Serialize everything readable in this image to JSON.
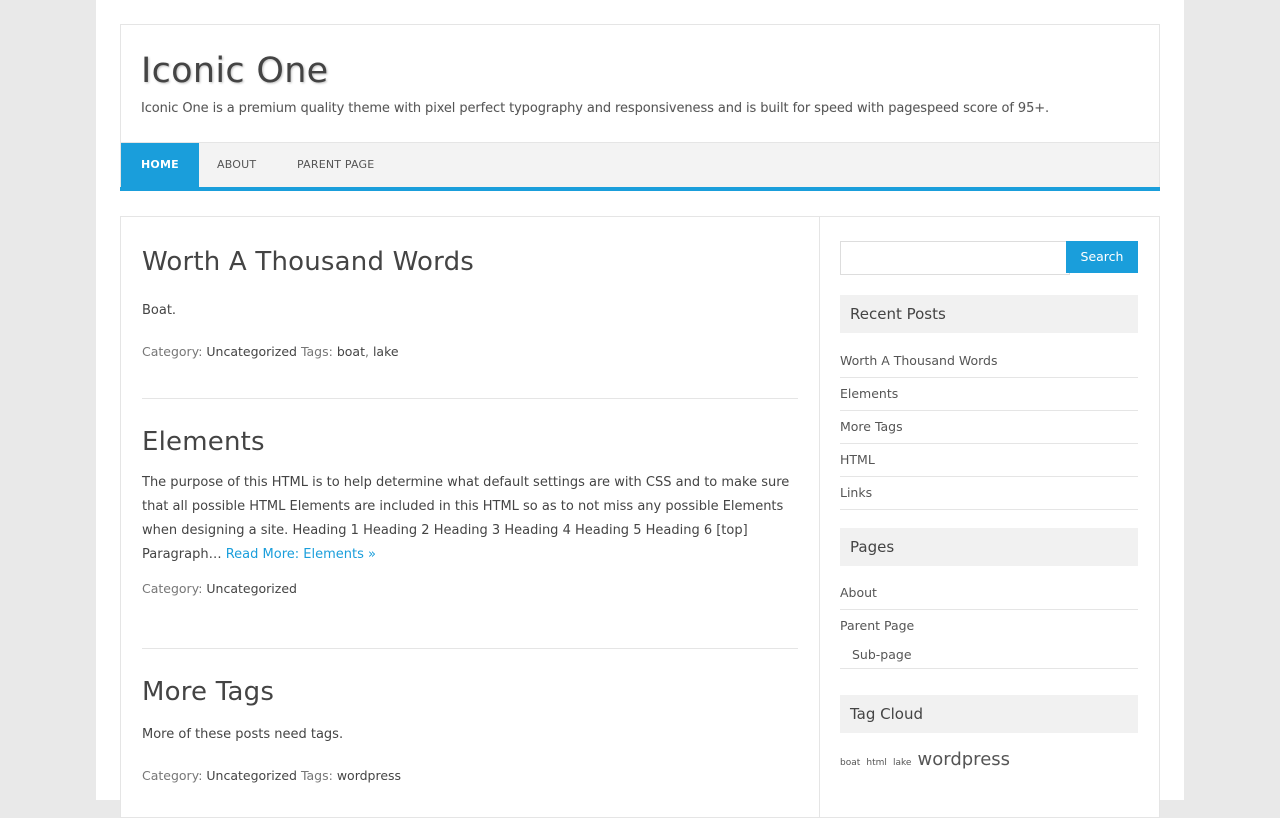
{
  "site": {
    "title": "Iconic One",
    "description": "Iconic One is a premium quality theme with pixel perfect typography and responsiveness and is built for speed with pagespeed score of 95+."
  },
  "nav": {
    "items": [
      {
        "label": "Home",
        "active": true
      },
      {
        "label": "About",
        "active": false
      },
      {
        "label": "Parent Page",
        "active": false
      }
    ]
  },
  "posts": [
    {
      "title": "Worth A Thousand Words",
      "excerpt": "Boat.",
      "meta": {
        "category_label": "Category:",
        "category": "Uncategorized",
        "tags_label": "Tags:",
        "tags": [
          "boat",
          "lake"
        ]
      }
    },
    {
      "title": "Elements",
      "excerpt": "The purpose of this HTML is to help determine what default settings are with CSS and to make sure that all possible HTML Elements are included in this HTML so as to not miss any possible Elements when designing a site. Heading 1 Heading 2 Heading 3 Heading 4 Heading 5 Heading 6 [top] Paragraph…",
      "read_more": "Read More: Elements »",
      "meta": {
        "category_label": "Category:",
        "category": "Uncategorized"
      }
    },
    {
      "title": "More Tags",
      "excerpt": "More of these posts need tags.",
      "meta": {
        "category_label": "Category:",
        "category": "Uncategorized",
        "tags_label": "Tags:",
        "tags": [
          "wordpress"
        ]
      }
    }
  ],
  "sidebar": {
    "search": {
      "placeholder": "",
      "button": "Search"
    },
    "recent_posts": {
      "title": "Recent Posts",
      "items": [
        "Worth A Thousand Words",
        "Elements",
        "More Tags",
        "HTML",
        "Links"
      ]
    },
    "pages": {
      "title": "Pages",
      "items": [
        "About",
        "Parent Page"
      ],
      "subitems": [
        "Sub-page"
      ]
    },
    "tag_cloud": {
      "title": "Tag Cloud",
      "tags": [
        "boat",
        "html",
        "lake",
        "wordpress"
      ]
    }
  },
  "colors": {
    "accent": "#1a9edb",
    "page_bg": "#e9e9e9",
    "widget_bg": "#f1f1f1"
  }
}
